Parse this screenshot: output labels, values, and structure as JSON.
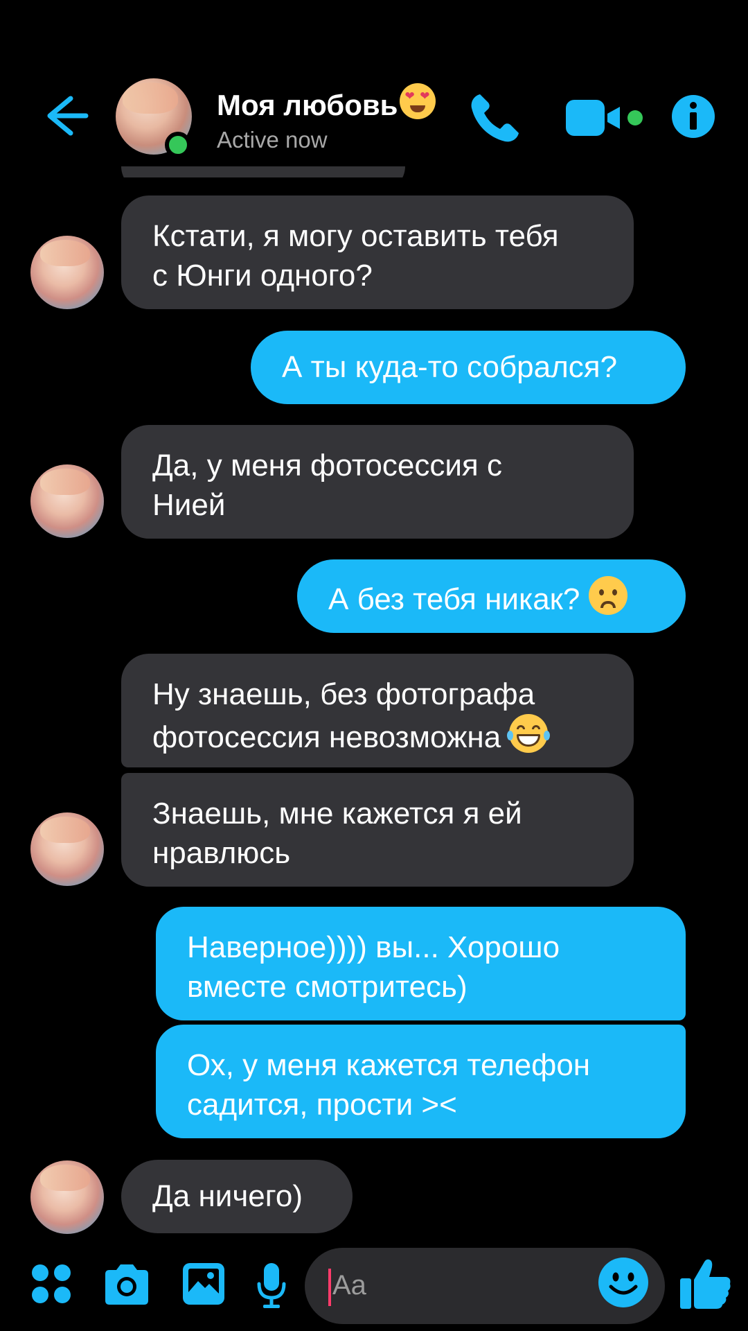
{
  "colors": {
    "accent": "#1bb9f8",
    "incoming_bubble": "#343438",
    "online": "#35c759",
    "background": "#000000"
  },
  "header": {
    "contact_name": "Моя любовь",
    "status": "Active now",
    "icons": [
      "back-arrow-icon",
      "phone-icon",
      "video-camera-icon",
      "info-icon"
    ]
  },
  "messages": [
    {
      "direction": "in",
      "text": "Кстати, я могу оставить тебя\nс Юнги одного?"
    },
    {
      "direction": "out",
      "text": "А ты куда-то собрался?"
    },
    {
      "direction": "in",
      "text": "Да, у меня фотосессия с\nНией"
    },
    {
      "direction": "out",
      "text": "А без тебя никак? ",
      "emoji": "worried-face"
    },
    {
      "direction": "in",
      "text": "Ну знаешь, без фотографа\nфотосессия невозможна ",
      "emoji": "tears-of-joy"
    },
    {
      "direction": "in",
      "text": "Знаешь, мне кажется я ей\nнравлюсь"
    },
    {
      "direction": "out",
      "text": "Наверное)))) вы... Хорошо\nвместе смотритесь)"
    },
    {
      "direction": "out",
      "text": "Ох, у меня кажется телефон\nсадится, прости ><"
    },
    {
      "direction": "in",
      "text": "Да ничего)"
    }
  ],
  "composer": {
    "placeholder": "Aa",
    "icons": [
      "apps-icon",
      "camera-icon",
      "gallery-icon",
      "microphone-icon",
      "emoji-icon",
      "thumbs-up-icon"
    ]
  }
}
